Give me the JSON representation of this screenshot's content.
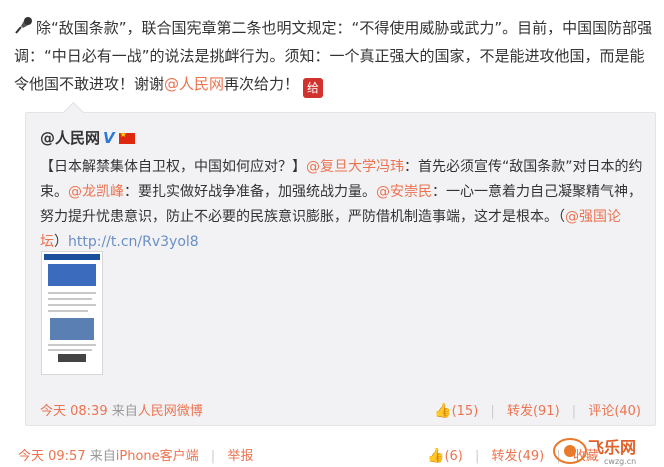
{
  "post": {
    "text_1": "除“敌国条款”，联合国宪章第二条也明文规定：“不得使用威胁或武力”。目前，中国国防部强调：“中日必有一战”的说法是挑衅行为。须知：一个真正强大的国家，不是能进攻他国，而是能令他国不敢进攻！谢谢",
    "mention": "@人民网",
    "text_2": "再次给力！",
    "gift_label": "给",
    "footer": {
      "time": "今天 09:57",
      "from_label": "来自",
      "source": "iPhone客户端",
      "report": "举报"
    },
    "actions": {
      "like_count": "(6)",
      "repost": "转发(49)",
      "favorite": "收藏"
    }
  },
  "quote": {
    "author": "@人民网",
    "vip": "V",
    "text_1": "【日本解禁集体自卫权，中国如何应对？】",
    "mention_1": "@复旦大学冯玮",
    "text_2": "：首先必须宣传“敌国条款”对日本的约束。",
    "mention_2": "@龙凯峰",
    "text_3": "：要扎实做好战争准备，加强统战力量。",
    "mention_3": "@安崇民",
    "text_4": "：一心一意着力自己凝聚精气神，努力提升忧患意识，防止不必要的民族意识膨胀，严防借机制造事端，这才是根本。（",
    "mention_4": "@强国论坛",
    "text_5": "）",
    "url": "http://t.cn/Rv3yol8",
    "footer": {
      "time": "今天 08:39",
      "from_label": "来自",
      "source": "人民网微博"
    },
    "actions": {
      "like_count": "(15)",
      "repost": "转发(91)",
      "comment": "评论(40)"
    }
  },
  "watermark": {
    "text": "飞乐网",
    "domain": "cwzg.cn"
  },
  "colors": {
    "link": "#eb7350",
    "url": "#6a8fc5",
    "quote_bg": "#f2f2f5"
  }
}
